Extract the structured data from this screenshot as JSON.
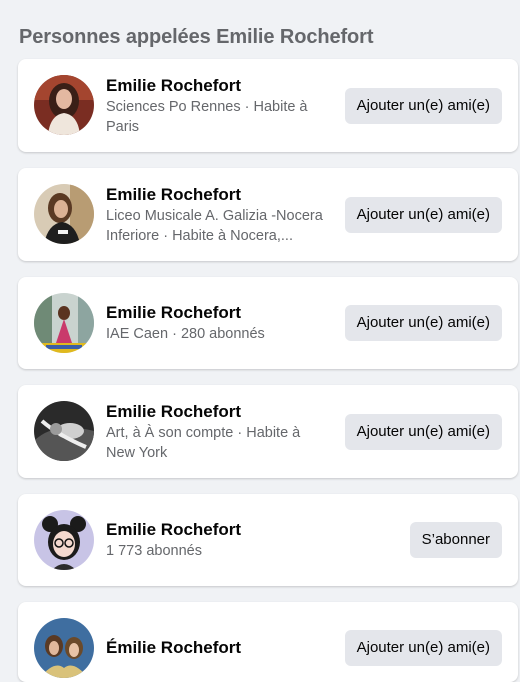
{
  "title": "Personnes appelées Emilie Rochefort",
  "people": [
    {
      "name": "Emilie Rochefort",
      "line1": "Sciences Po Rennes · Habite à",
      "line2": "Paris",
      "action": "Ajouter un(e) ami(e)",
      "avatar_icon": "profile-photo-woman-icon"
    },
    {
      "name": "Emilie Rochefort",
      "line1": "Liceo Musicale A. Galizia -Nocera",
      "line2": "Inferiore · Habite à Nocera,...",
      "action": "Ajouter un(e) ami(e)",
      "avatar_icon": "profile-photo-woman-icon"
    },
    {
      "name": "Emilie Rochefort",
      "line1": "IAE Caen · 280 abonnés",
      "line2": "",
      "action": "Ajouter un(e) ami(e)",
      "avatar_icon": "profile-photo-woman-icon"
    },
    {
      "name": "Emilie Rochefort",
      "line1": "Art, à À son compte · Habite à",
      "line2": "New York",
      "action": "Ajouter un(e) ami(e)",
      "avatar_icon": "profile-photo-bw-icon"
    },
    {
      "name": "Emilie Rochefort",
      "line1": "1 773 abonnés",
      "line2": "",
      "action": "S’abonner",
      "avatar_icon": "profile-photo-illustration-icon"
    },
    {
      "name": "Émilie Rochefort",
      "line1": "",
      "line2": "",
      "action": "Ajouter un(e) ami(e)",
      "avatar_icon": "profile-photo-group-icon"
    }
  ]
}
